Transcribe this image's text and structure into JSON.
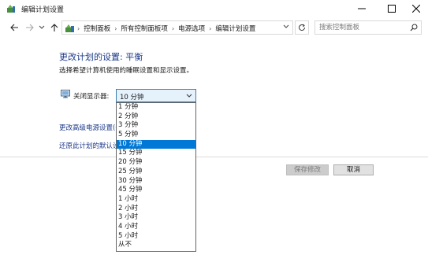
{
  "window": {
    "title": "编辑计划设置",
    "minimize_icon": "minimize-icon",
    "maximize_icon": "maximize-icon",
    "close_icon": "close-icon"
  },
  "navigation": {
    "breadcrumbs": [
      "控制面板",
      "所有控制面板项",
      "电源选项",
      "编辑计划设置"
    ],
    "search_placeholder": "搜索控制面板"
  },
  "content": {
    "title": "更改计划的设置: 平衡",
    "subtitle": "选择希望计算机使用的睡眠设置和显示设置。",
    "display_off": {
      "label": "关闭显示器:",
      "selected_value": "10 分钟",
      "options": [
        "1 分钟",
        "2 分钟",
        "3 分钟",
        "5 分钟",
        "10 分钟",
        "15 分钟",
        "20 分钟",
        "25 分钟",
        "30 分钟",
        "45 分钟",
        "1 小时",
        "2 小时",
        "3 小时",
        "4 小时",
        "5 小时",
        "从不"
      ],
      "highlighted_option": "10 分钟"
    },
    "links": {
      "advanced": "更改高级电源设置(C)",
      "restore": "还原此计划的默认设置(R)"
    },
    "buttons": {
      "save": "保存修改",
      "cancel": "取消"
    }
  },
  "colors": {
    "title_blue": "#1e3a8a",
    "selection_blue": "#0078d7",
    "select_border": "#3c7fb1"
  }
}
